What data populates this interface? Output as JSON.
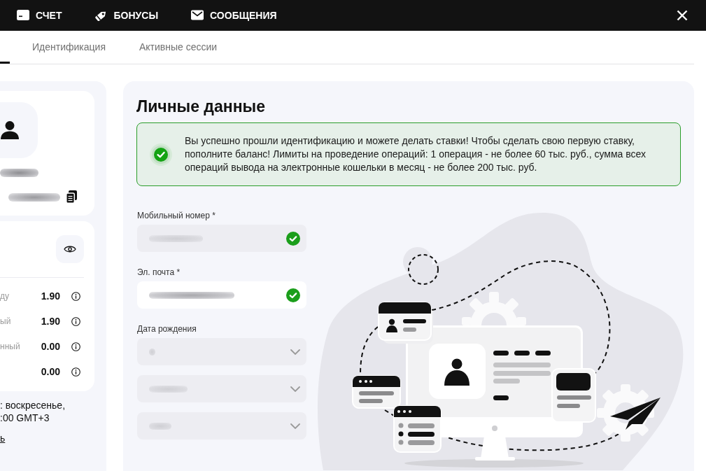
{
  "top_nav": [
    {
      "kind": "account",
      "label": "СЧЕТ"
    },
    {
      "kind": "bonuses",
      "label": "БОНУСЫ"
    },
    {
      "kind": "messages",
      "label": "СООБЩЕНИЯ"
    }
  ],
  "tabs": [
    {
      "selected": true
    },
    {
      "label": "Идентификация",
      "selected": false
    },
    {
      "label": "Активные сессии",
      "selected": false
    }
  ],
  "balance": {
    "rows": [
      {
        "label": "ду",
        "value": "1.90"
      },
      {
        "label": "ый",
        "value": "1.90"
      },
      {
        "label": "нный",
        "value": "0.00"
      },
      {
        "value": "0.00"
      }
    ]
  },
  "schedule_note": {
    "lines": [
      ": воскресенье,",
      ":00 GMT+3"
    ],
    "link": "ь"
  },
  "personal_data": {
    "title": "Личные данные",
    "alert": {
      "kind": "success",
      "text": "Вы успешно прошли идентификацию и можете делать ставки! Чтобы сделать свою первую ставку, пополните баланс! Лимиты на проведение операций: 1 операция - не более 60 тыс. руб., сумма всех операций вывода на электронные кошельки в месяц - не более 200 тыс. руб."
    },
    "fields": [
      {
        "kind": "input",
        "label": "Мобильный номер *",
        "disabled": true,
        "verified": true
      },
      {
        "kind": "input",
        "label": "Эл. почта *",
        "disabled": false,
        "verified": true
      },
      {
        "kind": "select",
        "label": "Дата рождения",
        "disabled": true
      },
      {
        "kind": "select",
        "disabled": true
      },
      {
        "kind": "select",
        "disabled": true
      }
    ]
  }
}
